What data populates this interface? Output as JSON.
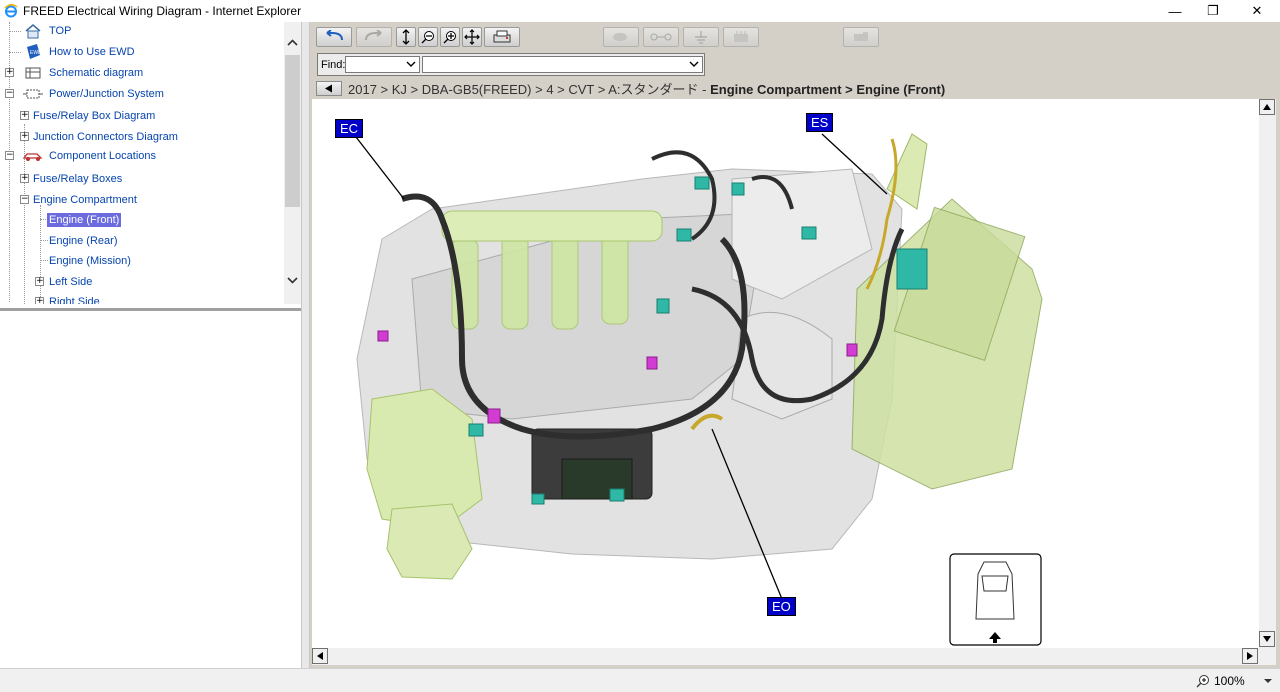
{
  "window": {
    "title": "FREED Electrical Wiring Diagram - Internet Explorer",
    "minimize_glyph": "—",
    "restore_glyph": "❐",
    "close_glyph": "✕"
  },
  "tree": {
    "items": [
      {
        "label": "TOP",
        "icon": "home-icon"
      },
      {
        "label": "How to Use EWD",
        "icon": "ewd-book-icon"
      },
      {
        "label": "Schematic diagram",
        "icon": "schematic-icon"
      },
      {
        "label": "Power/Junction System",
        "icon": "circuit-icon"
      },
      {
        "label": "Fuse/Relay Box Diagram"
      },
      {
        "label": "Junction Connectors Diagram"
      },
      {
        "label": "Component Locations",
        "icon": "car-icon"
      },
      {
        "label": "Fuse/Relay Boxes"
      },
      {
        "label": "Engine Compartment"
      },
      {
        "label": "Engine (Front)",
        "selected": true
      },
      {
        "label": "Engine (Rear)"
      },
      {
        "label": "Engine (Mission)"
      },
      {
        "label": "Left Side"
      },
      {
        "label": "Right Side"
      }
    ]
  },
  "find": {
    "label": "Find:"
  },
  "breadcrumb": {
    "path": "2017 > KJ > DBA-GB5(FREED) > 4 > CVT > A:スタンダード - ",
    "current": "Engine Compartment > Engine (Front)"
  },
  "callouts": {
    "ec": "EC",
    "es": "ES",
    "eo": "EO"
  },
  "status": {
    "zoom": "100%"
  },
  "colors": {
    "callout_bg": "#0000c8",
    "selected_bg": "#6b6bdf",
    "link": "#0645ad"
  }
}
